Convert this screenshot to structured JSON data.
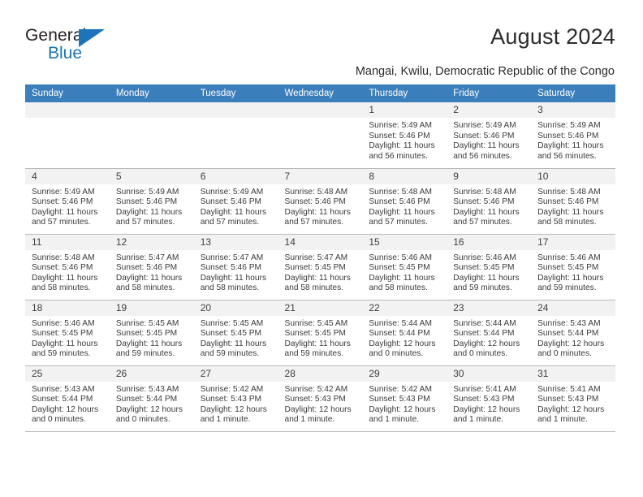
{
  "brand": {
    "line1": "General",
    "line2": "Blue",
    "accent_color": "#1b75bb"
  },
  "header": {
    "title": "August 2024",
    "subtitle": "Mangai, Kwilu, Democratic Republic of the Congo",
    "header_bg": "#3b7ebc"
  },
  "calendar": {
    "weekday_headers": [
      "Sunday",
      "Monday",
      "Tuesday",
      "Wednesday",
      "Thursday",
      "Friday",
      "Saturday"
    ],
    "weeks": [
      [
        {
          "day": "",
          "empty": true
        },
        {
          "day": "",
          "empty": true
        },
        {
          "day": "",
          "empty": true
        },
        {
          "day": "",
          "empty": true
        },
        {
          "day": "1",
          "sunrise": "Sunrise: 5:49 AM",
          "sunset": "Sunset: 5:46 PM",
          "daylight": "Daylight: 11 hours and 56 minutes."
        },
        {
          "day": "2",
          "sunrise": "Sunrise: 5:49 AM",
          "sunset": "Sunset: 5:46 PM",
          "daylight": "Daylight: 11 hours and 56 minutes."
        },
        {
          "day": "3",
          "sunrise": "Sunrise: 5:49 AM",
          "sunset": "Sunset: 5:46 PM",
          "daylight": "Daylight: 11 hours and 56 minutes."
        }
      ],
      [
        {
          "day": "4",
          "sunrise": "Sunrise: 5:49 AM",
          "sunset": "Sunset: 5:46 PM",
          "daylight": "Daylight: 11 hours and 57 minutes."
        },
        {
          "day": "5",
          "sunrise": "Sunrise: 5:49 AM",
          "sunset": "Sunset: 5:46 PM",
          "daylight": "Daylight: 11 hours and 57 minutes."
        },
        {
          "day": "6",
          "sunrise": "Sunrise: 5:49 AM",
          "sunset": "Sunset: 5:46 PM",
          "daylight": "Daylight: 11 hours and 57 minutes."
        },
        {
          "day": "7",
          "sunrise": "Sunrise: 5:48 AM",
          "sunset": "Sunset: 5:46 PM",
          "daylight": "Daylight: 11 hours and 57 minutes."
        },
        {
          "day": "8",
          "sunrise": "Sunrise: 5:48 AM",
          "sunset": "Sunset: 5:46 PM",
          "daylight": "Daylight: 11 hours and 57 minutes."
        },
        {
          "day": "9",
          "sunrise": "Sunrise: 5:48 AM",
          "sunset": "Sunset: 5:46 PM",
          "daylight": "Daylight: 11 hours and 57 minutes."
        },
        {
          "day": "10",
          "sunrise": "Sunrise: 5:48 AM",
          "sunset": "Sunset: 5:46 PM",
          "daylight": "Daylight: 11 hours and 58 minutes."
        }
      ],
      [
        {
          "day": "11",
          "sunrise": "Sunrise: 5:48 AM",
          "sunset": "Sunset: 5:46 PM",
          "daylight": "Daylight: 11 hours and 58 minutes."
        },
        {
          "day": "12",
          "sunrise": "Sunrise: 5:47 AM",
          "sunset": "Sunset: 5:46 PM",
          "daylight": "Daylight: 11 hours and 58 minutes."
        },
        {
          "day": "13",
          "sunrise": "Sunrise: 5:47 AM",
          "sunset": "Sunset: 5:46 PM",
          "daylight": "Daylight: 11 hours and 58 minutes."
        },
        {
          "day": "14",
          "sunrise": "Sunrise: 5:47 AM",
          "sunset": "Sunset: 5:45 PM",
          "daylight": "Daylight: 11 hours and 58 minutes."
        },
        {
          "day": "15",
          "sunrise": "Sunrise: 5:46 AM",
          "sunset": "Sunset: 5:45 PM",
          "daylight": "Daylight: 11 hours and 58 minutes."
        },
        {
          "day": "16",
          "sunrise": "Sunrise: 5:46 AM",
          "sunset": "Sunset: 5:45 PM",
          "daylight": "Daylight: 11 hours and 59 minutes."
        },
        {
          "day": "17",
          "sunrise": "Sunrise: 5:46 AM",
          "sunset": "Sunset: 5:45 PM",
          "daylight": "Daylight: 11 hours and 59 minutes."
        }
      ],
      [
        {
          "day": "18",
          "sunrise": "Sunrise: 5:46 AM",
          "sunset": "Sunset: 5:45 PM",
          "daylight": "Daylight: 11 hours and 59 minutes."
        },
        {
          "day": "19",
          "sunrise": "Sunrise: 5:45 AM",
          "sunset": "Sunset: 5:45 PM",
          "daylight": "Daylight: 11 hours and 59 minutes."
        },
        {
          "day": "20",
          "sunrise": "Sunrise: 5:45 AM",
          "sunset": "Sunset: 5:45 PM",
          "daylight": "Daylight: 11 hours and 59 minutes."
        },
        {
          "day": "21",
          "sunrise": "Sunrise: 5:45 AM",
          "sunset": "Sunset: 5:45 PM",
          "daylight": "Daylight: 11 hours and 59 minutes."
        },
        {
          "day": "22",
          "sunrise": "Sunrise: 5:44 AM",
          "sunset": "Sunset: 5:44 PM",
          "daylight": "Daylight: 12 hours and 0 minutes."
        },
        {
          "day": "23",
          "sunrise": "Sunrise: 5:44 AM",
          "sunset": "Sunset: 5:44 PM",
          "daylight": "Daylight: 12 hours and 0 minutes."
        },
        {
          "day": "24",
          "sunrise": "Sunrise: 5:43 AM",
          "sunset": "Sunset: 5:44 PM",
          "daylight": "Daylight: 12 hours and 0 minutes."
        }
      ],
      [
        {
          "day": "25",
          "sunrise": "Sunrise: 5:43 AM",
          "sunset": "Sunset: 5:44 PM",
          "daylight": "Daylight: 12 hours and 0 minutes."
        },
        {
          "day": "26",
          "sunrise": "Sunrise: 5:43 AM",
          "sunset": "Sunset: 5:44 PM",
          "daylight": "Daylight: 12 hours and 0 minutes."
        },
        {
          "day": "27",
          "sunrise": "Sunrise: 5:42 AM",
          "sunset": "Sunset: 5:43 PM",
          "daylight": "Daylight: 12 hours and 1 minute."
        },
        {
          "day": "28",
          "sunrise": "Sunrise: 5:42 AM",
          "sunset": "Sunset: 5:43 PM",
          "daylight": "Daylight: 12 hours and 1 minute."
        },
        {
          "day": "29",
          "sunrise": "Sunrise: 5:42 AM",
          "sunset": "Sunset: 5:43 PM",
          "daylight": "Daylight: 12 hours and 1 minute."
        },
        {
          "day": "30",
          "sunrise": "Sunrise: 5:41 AM",
          "sunset": "Sunset: 5:43 PM",
          "daylight": "Daylight: 12 hours and 1 minute."
        },
        {
          "day": "31",
          "sunrise": "Sunrise: 5:41 AM",
          "sunset": "Sunset: 5:43 PM",
          "daylight": "Daylight: 12 hours and 1 minute."
        }
      ]
    ]
  }
}
